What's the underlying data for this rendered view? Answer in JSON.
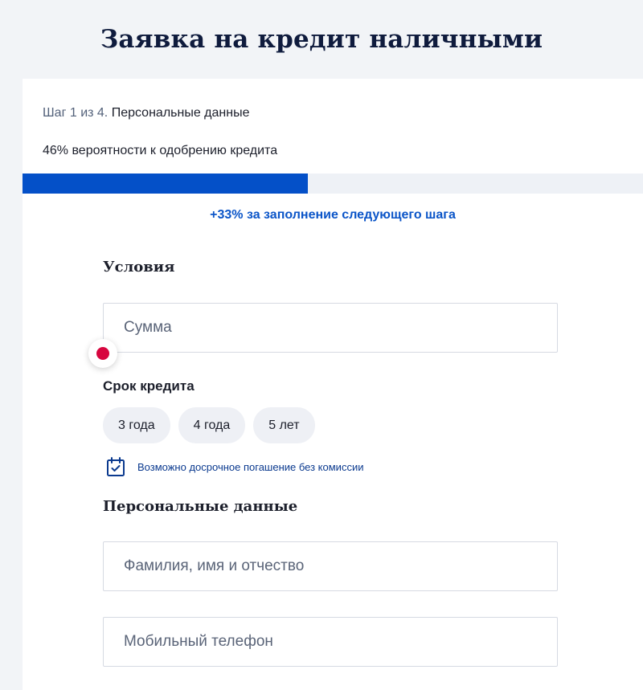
{
  "page": {
    "title": "Заявка на кредит наличными"
  },
  "progress": {
    "step_prefix": "Шаг 1 из 4.",
    "step_name": "Персональные данные",
    "probability_text": "46% вероятности к одобрению кредита",
    "fill_fraction": 0.46,
    "next_step_bonus": "+33% за заполнение следующего шага",
    "fill_color": "#0450c8"
  },
  "conditions": {
    "title": "Условия",
    "amount_placeholder": "Сумма",
    "error_color": "#d7063f",
    "term_label": "Срок кредита",
    "term_options": [
      "3 года",
      "4 года",
      "5 лет"
    ],
    "early_repayment_note": "Возможно досрочное погашение без комиссии",
    "note_icon": "calendar-check-icon"
  },
  "personal": {
    "title": "Персональные данные",
    "fullname_placeholder": "Фамилия, имя и отчество",
    "phone_placeholder": "Мобильный телефон"
  }
}
